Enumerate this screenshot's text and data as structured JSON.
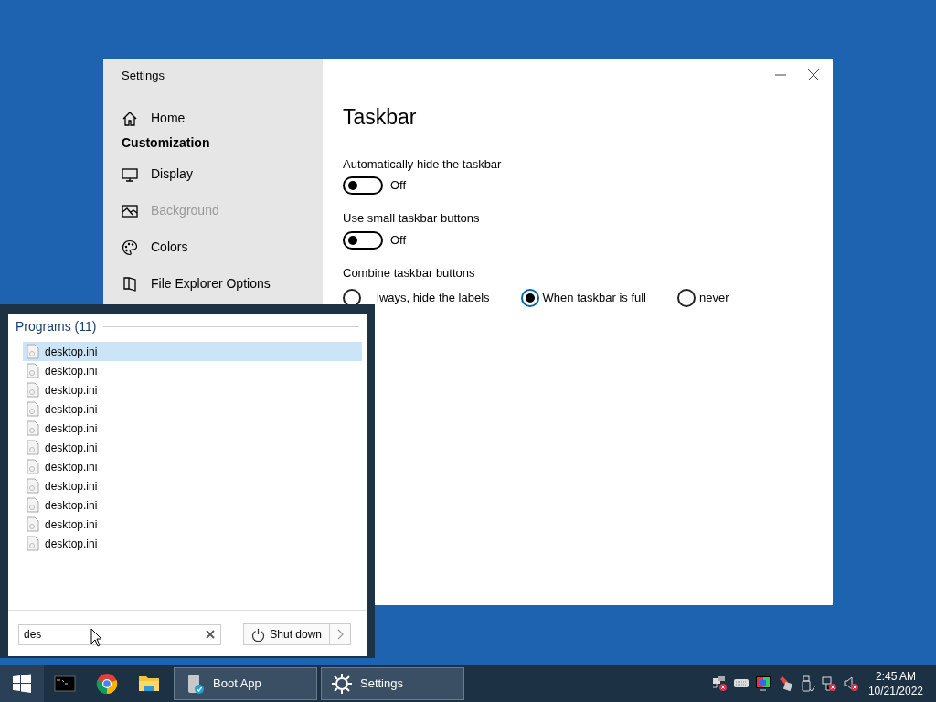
{
  "settings_window": {
    "title": "Settings",
    "sidebar": {
      "home": "Home",
      "section": "Customization",
      "items": [
        {
          "label": "Display",
          "disabled": false
        },
        {
          "label": "Background",
          "disabled": true
        },
        {
          "label": "Colors",
          "disabled": false
        },
        {
          "label": "File Explorer Options",
          "disabled": false
        }
      ]
    },
    "page_title": "Taskbar",
    "toggles": [
      {
        "label": "Automatically hide the taskbar",
        "on": false,
        "state_text": "Off"
      },
      {
        "label": "Use small taskbar buttons",
        "on": false,
        "state_text": "Off"
      }
    ],
    "combine": {
      "label": "Combine taskbar buttons",
      "options": [
        {
          "label": "lways, hide the labels",
          "selected": false
        },
        {
          "label": "When taskbar is full",
          "selected": true
        },
        {
          "label": "never",
          "selected": false
        }
      ]
    }
  },
  "start_menu": {
    "group": "Programs (11)",
    "results": [
      {
        "label": "desktop.ini",
        "selected": true
      },
      {
        "label": "desktop.ini",
        "selected": false
      },
      {
        "label": "desktop.ini",
        "selected": false
      },
      {
        "label": "desktop.ini",
        "selected": false
      },
      {
        "label": "desktop.ini",
        "selected": false
      },
      {
        "label": "desktop.ini",
        "selected": false
      },
      {
        "label": "desktop.ini",
        "selected": false
      },
      {
        "label": "desktop.ini",
        "selected": false
      },
      {
        "label": "desktop.ini",
        "selected": false
      },
      {
        "label": "desktop.ini",
        "selected": false
      },
      {
        "label": "desktop.ini",
        "selected": false
      }
    ],
    "search": {
      "value": "des"
    },
    "shutdown": "Shut down"
  },
  "taskbar": {
    "windows": [
      {
        "label": "Boot App"
      },
      {
        "label": "Settings"
      }
    ],
    "clock": {
      "time": "2:45 AM",
      "date": "10/21/2022"
    }
  }
}
